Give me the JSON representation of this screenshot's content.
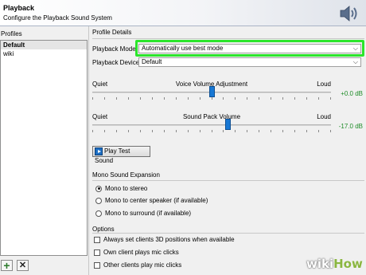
{
  "header": {
    "title": "Playback",
    "subtitle": "Configure the Playback Sound System",
    "icon": "speaker-icon"
  },
  "profiles": {
    "label": "Profiles",
    "items": [
      {
        "label": "Default",
        "selected": true
      },
      {
        "label": "wiki",
        "selected": false
      }
    ],
    "add_icon": "plus-icon",
    "remove_icon": "x-icon"
  },
  "details": {
    "title": "Profile Details",
    "playback_mode": {
      "label": "Playback Mode:",
      "value": "Automatically use best mode"
    },
    "playback_device": {
      "label": "Playback Device:",
      "value": "Default"
    },
    "voice_slider": {
      "title": "Voice Volume Adjustment",
      "quiet": "Quiet",
      "loud": "Loud",
      "value_text": "+0.0 dB",
      "level": 0.5
    },
    "pack_slider": {
      "title": "Sound Pack Volume",
      "quiet": "Quiet",
      "loud": "Loud",
      "value_text": "-17.0 dB",
      "level": 0.57
    },
    "play_test": "Play Test Sound"
  },
  "mono": {
    "title": "Mono Sound Expansion",
    "options": [
      {
        "label": "Mono to stereo",
        "selected": true
      },
      {
        "label": "Mono to center speaker (if available)",
        "selected": false
      },
      {
        "label": "Mono to surround (if available)",
        "selected": false
      }
    ]
  },
  "options": {
    "title": "Options",
    "items": [
      {
        "label": "Always set clients 3D positions when available",
        "checked": false
      },
      {
        "label": "Own client plays mic clicks",
        "checked": false
      },
      {
        "label": "Other clients play mic clicks",
        "checked": false
      }
    ]
  },
  "watermark": {
    "part1": "wiki",
    "part2": "How"
  },
  "colors": {
    "highlight": "#2be52b",
    "db_value": "#1e8c28",
    "thumb": "#1878d4"
  }
}
